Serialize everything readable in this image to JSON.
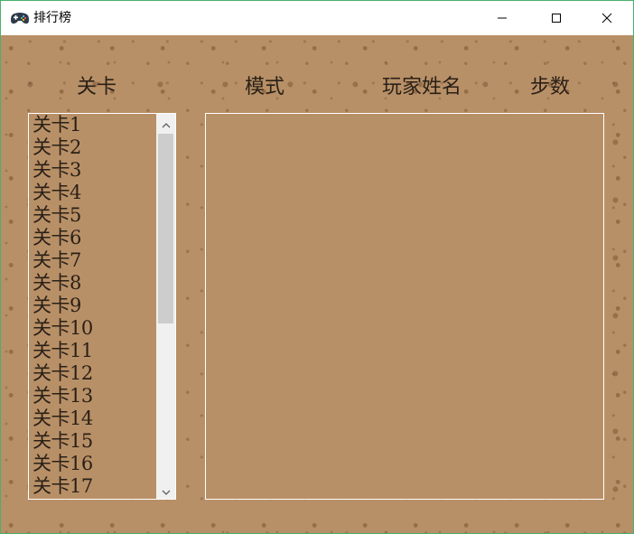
{
  "window": {
    "title": "排行榜",
    "icon": "gamepad-icon"
  },
  "titlebar": {
    "minimize_icon": "minimize-icon",
    "maximize_icon": "maximize-icon",
    "close_icon": "close-icon"
  },
  "headers": {
    "level": "关卡",
    "mode": "模式",
    "player_name": "玩家姓名",
    "steps": "步数"
  },
  "level_list": {
    "items": [
      "关卡1",
      "关卡2",
      "关卡3",
      "关卡4",
      "关卡5",
      "关卡6",
      "关卡7",
      "关卡8",
      "关卡9",
      "关卡10",
      "关卡11",
      "关卡12",
      "关卡13",
      "关卡14",
      "关卡15",
      "关卡16",
      "关卡17"
    ],
    "scroll_fraction_visible": 0.55
  },
  "colors": {
    "background": "#b89067",
    "text": "#2a2017",
    "border": "#ffffff",
    "window_border": "#4caf6e"
  }
}
